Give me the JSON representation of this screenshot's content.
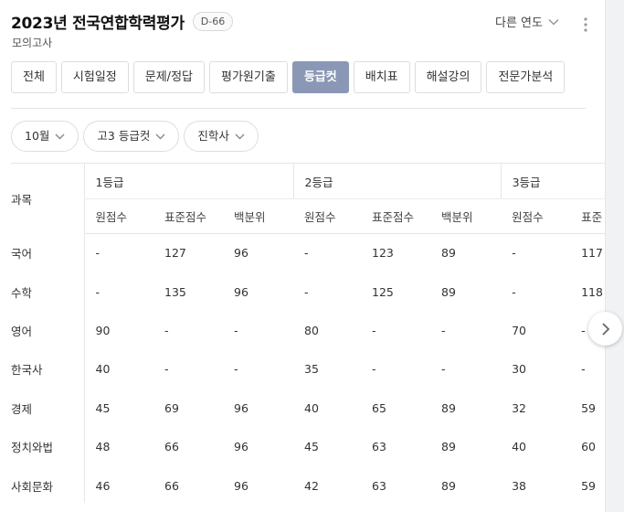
{
  "header": {
    "title": "2023년 전국연합학력평가",
    "dday": "D-66",
    "subtitle": "모의고사",
    "year_select": "다른 연도"
  },
  "tabs": [
    {
      "label": "전체",
      "active": false
    },
    {
      "label": "시험일정",
      "active": false
    },
    {
      "label": "문제/정답",
      "active": false
    },
    {
      "label": "평가원기출",
      "active": false
    },
    {
      "label": "등급컷",
      "active": true
    },
    {
      "label": "배치표",
      "active": false
    },
    {
      "label": "해설강의",
      "active": false
    },
    {
      "label": "전문가분석",
      "active": false
    }
  ],
  "filters": {
    "month": "10월",
    "type": "고3 등급컷",
    "source": "진학사"
  },
  "table": {
    "subject_header": "과목",
    "grades": [
      "1등급",
      "2등급",
      "3등급"
    ],
    "columns": [
      "원점수",
      "표준점수",
      "백분위",
      "원점수",
      "표준점수",
      "백분위",
      "원점수",
      "표준"
    ],
    "rows": [
      {
        "subject": "국어",
        "cells": [
          "-",
          "127",
          "96",
          "-",
          "123",
          "89",
          "-",
          "117"
        ]
      },
      {
        "subject": "수학",
        "cells": [
          "-",
          "135",
          "96",
          "-",
          "125",
          "89",
          "-",
          "118"
        ]
      },
      {
        "subject": "영어",
        "cells": [
          "90",
          "-",
          "-",
          "80",
          "-",
          "-",
          "70",
          "-"
        ]
      },
      {
        "subject": "한국사",
        "cells": [
          "40",
          "-",
          "-",
          "35",
          "-",
          "-",
          "30",
          "-"
        ]
      },
      {
        "subject": "경제",
        "cells": [
          "45",
          "69",
          "96",
          "40",
          "65",
          "89",
          "32",
          "59"
        ]
      },
      {
        "subject": "정치와법",
        "cells": [
          "48",
          "66",
          "96",
          "45",
          "63",
          "89",
          "40",
          "60"
        ]
      },
      {
        "subject": "사회문화",
        "cells": [
          "46",
          "66",
          "96",
          "42",
          "63",
          "89",
          "38",
          "59"
        ]
      }
    ]
  },
  "icons": {
    "year_chevron": "chevron-down-icon",
    "more": "more-vertical-icon",
    "filter_chevron": "chevron-down-icon",
    "next": "chevron-right-icon"
  }
}
